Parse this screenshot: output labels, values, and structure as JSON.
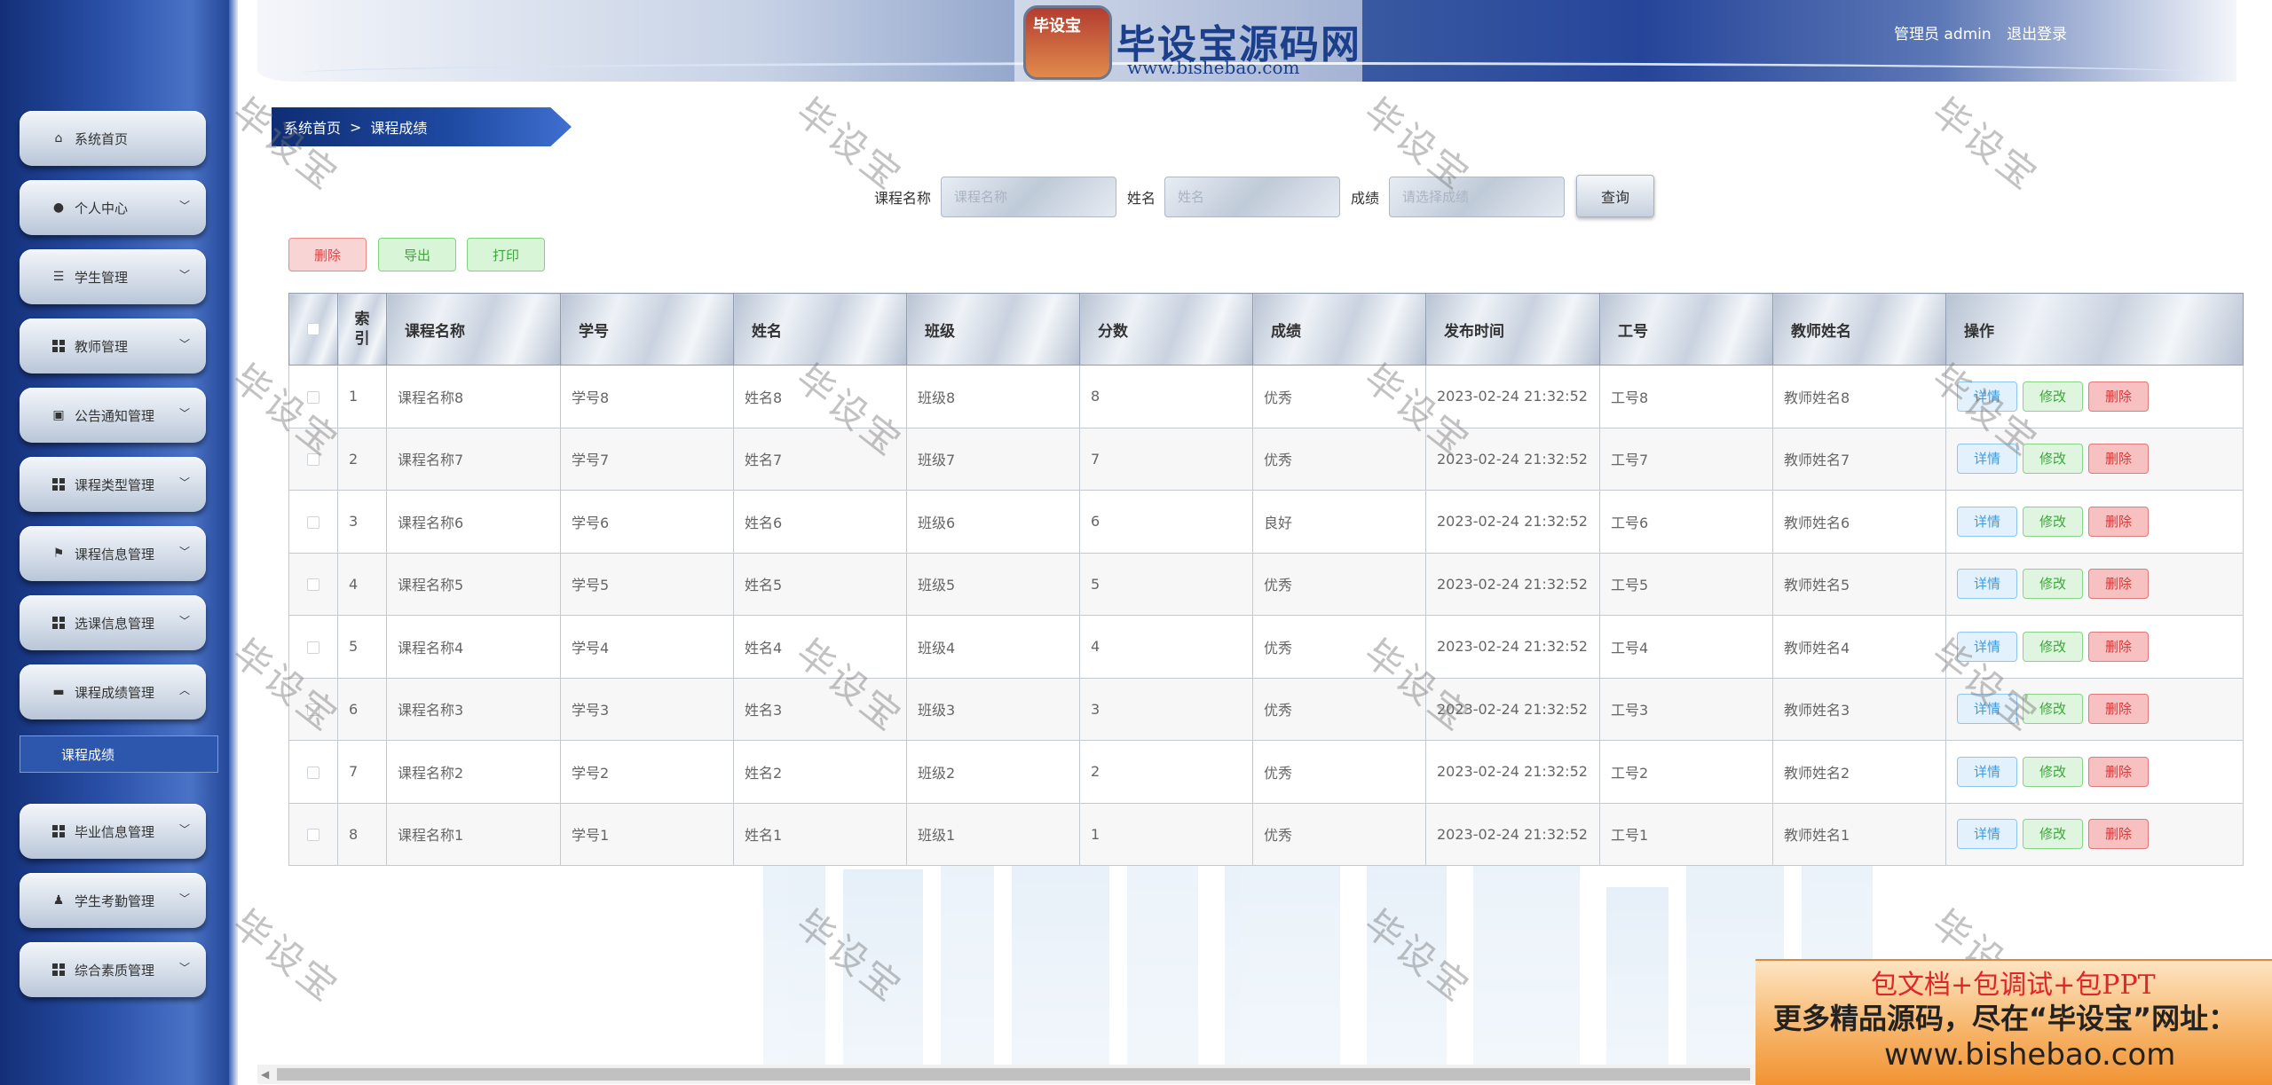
{
  "header": {
    "logo_badge": "毕设宝",
    "logo_title": "毕设宝源码网",
    "logo_url": "www.bishebao.com",
    "user_label": "管理员 admin",
    "logout": "退出登录"
  },
  "sidebar": {
    "items": [
      {
        "label": "系统首页",
        "icon": "home-icon"
      },
      {
        "label": "个人中心",
        "icon": "user-icon"
      },
      {
        "label": "学生管理",
        "icon": "list-icon"
      },
      {
        "label": "教师管理",
        "icon": "grid-icon"
      },
      {
        "label": "公告通知管理",
        "icon": "clipboard-icon"
      },
      {
        "label": "课程类型管理",
        "icon": "grid-icon"
      },
      {
        "label": "课程信息管理",
        "icon": "flag-icon"
      },
      {
        "label": "选课信息管理",
        "icon": "grid-icon"
      },
      {
        "label": "课程成绩管理",
        "icon": "briefcase-icon"
      },
      {
        "label": "毕业信息管理",
        "icon": "grid-icon"
      },
      {
        "label": "学生考勤管理",
        "icon": "user-check-icon"
      },
      {
        "label": "综合素质管理",
        "icon": "grid-icon"
      }
    ],
    "submenu_active": "课程成绩"
  },
  "breadcrumb": {
    "home": "系统首页",
    "sep": ">",
    "current": "课程成绩"
  },
  "search": {
    "course_label": "课程名称",
    "course_placeholder": "课程名称",
    "name_label": "姓名",
    "name_placeholder": "姓名",
    "grade_label": "成绩",
    "grade_placeholder": "请选择成绩",
    "button": "查询"
  },
  "actions": {
    "delete": "删除",
    "export": "导出",
    "print": "打印"
  },
  "table": {
    "headers": [
      "索引",
      "课程名称",
      "学号",
      "姓名",
      "班级",
      "分数",
      "成绩",
      "发布时间",
      "工号",
      "教师姓名",
      "操作"
    ],
    "rows": [
      [
        "1",
        "课程名称8",
        "学号8",
        "姓名8",
        "班级8",
        "8",
        "优秀",
        "2023-02-24 21:32:52",
        "工号8",
        "教师姓名8"
      ],
      [
        "2",
        "课程名称7",
        "学号7",
        "姓名7",
        "班级7",
        "7",
        "优秀",
        "2023-02-24 21:32:52",
        "工号7",
        "教师姓名7"
      ],
      [
        "3",
        "课程名称6",
        "学号6",
        "姓名6",
        "班级6",
        "6",
        "良好",
        "2023-02-24 21:32:52",
        "工号6",
        "教师姓名6"
      ],
      [
        "4",
        "课程名称5",
        "学号5",
        "姓名5",
        "班级5",
        "5",
        "优秀",
        "2023-02-24 21:32:52",
        "工号5",
        "教师姓名5"
      ],
      [
        "5",
        "课程名称4",
        "学号4",
        "姓名4",
        "班级4",
        "4",
        "优秀",
        "2023-02-24 21:32:52",
        "工号4",
        "教师姓名4"
      ],
      [
        "6",
        "课程名称3",
        "学号3",
        "姓名3",
        "班级3",
        "3",
        "优秀",
        "2023-02-24 21:32:52",
        "工号3",
        "教师姓名3"
      ],
      [
        "7",
        "课程名称2",
        "学号2",
        "姓名2",
        "班级2",
        "2",
        "优秀",
        "2023-02-24 21:32:52",
        "工号2",
        "教师姓名2"
      ],
      [
        "8",
        "课程名称1",
        "学号1",
        "姓名1",
        "班级1",
        "1",
        "优秀",
        "2023-02-24 21:32:52",
        "工号1",
        "教师姓名1"
      ]
    ],
    "op_detail": "详情",
    "op_edit": "修改",
    "op_delete": "删除"
  },
  "watermark": "毕设宝",
  "promo": {
    "line1": "包文档+包调试+包PPT",
    "line2": "更多精品源码，尽在“毕设宝”网址：",
    "line3": "www.bishebao.com"
  },
  "colors": {
    "accent": "#1e4aa2",
    "danger": "#e04646",
    "success": "#3fa53d",
    "info": "#3d9be0"
  }
}
